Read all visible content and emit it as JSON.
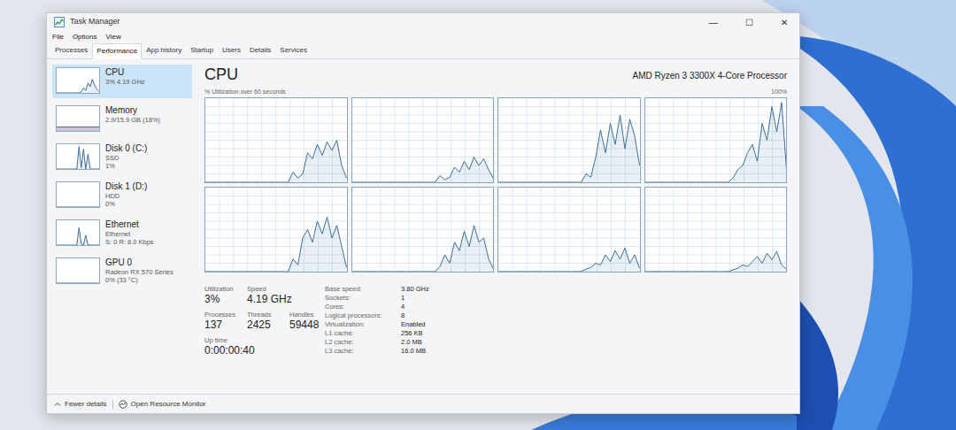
{
  "window": {
    "title": "Task Manager",
    "controls": [
      "—",
      "☐",
      "✕"
    ]
  },
  "menu": [
    "File",
    "Options",
    "View"
  ],
  "tabs": [
    {
      "label": "Processes",
      "selected": false
    },
    {
      "label": "Performance",
      "selected": true
    },
    {
      "label": "App history",
      "selected": false
    },
    {
      "label": "Startup",
      "selected": false
    },
    {
      "label": "Users",
      "selected": false
    },
    {
      "label": "Details",
      "selected": false
    },
    {
      "label": "Services",
      "selected": false
    }
  ],
  "sidebar": {
    "items": [
      {
        "title": "CPU",
        "lines": [
          "3% 4.19 GHz"
        ],
        "selected": true,
        "kind": "line",
        "values": [
          0,
          0,
          0,
          0,
          0,
          0,
          0,
          0,
          0,
          0,
          0,
          5,
          20,
          10,
          40,
          25,
          55,
          30,
          15,
          5
        ]
      },
      {
        "title": "Memory",
        "lines": [
          "2.9/15.9 GB (18%)"
        ],
        "selected": false,
        "kind": "fill",
        "level": 0.18
      },
      {
        "title": "Disk 0 (C:)",
        "lines": [
          "SSD",
          "1%"
        ],
        "selected": false,
        "kind": "line",
        "values": [
          0,
          0,
          0,
          0,
          0,
          0,
          0,
          0,
          0,
          0,
          90,
          5,
          80,
          0,
          60,
          0,
          0,
          0,
          0,
          0
        ]
      },
      {
        "title": "Disk 1 (D:)",
        "lines": [
          "HDD",
          "0%"
        ],
        "selected": false,
        "kind": "line",
        "values": [
          0,
          0,
          0,
          0,
          0,
          0,
          0,
          0,
          0,
          0,
          0,
          0,
          0,
          0,
          0,
          0,
          0,
          0,
          0,
          0
        ]
      },
      {
        "title": "Ethernet",
        "lines": [
          "Ethernet",
          "S: 0 R: 8.0 Kbps"
        ],
        "selected": false,
        "kind": "line",
        "values": [
          0,
          0,
          0,
          0,
          0,
          0,
          0,
          0,
          0,
          0,
          70,
          5,
          0,
          40,
          0,
          0,
          0,
          0,
          0,
          0
        ]
      },
      {
        "title": "GPU 0",
        "lines": [
          "Radeon RX 570 Series",
          "0% (33 °C)"
        ],
        "selected": false,
        "kind": "line",
        "values": [
          0,
          0,
          0,
          0,
          0,
          0,
          0,
          0,
          0,
          0,
          0,
          0,
          0,
          0,
          0,
          0,
          0,
          0,
          0,
          0
        ]
      }
    ]
  },
  "panel": {
    "title": "CPU",
    "device": "AMD Ryzen 3 3300X 4-Core Processor",
    "axis_label": "% Utilization over 60 seconds",
    "axis_max": "100%",
    "cores": [
      {
        "values": [
          0,
          0,
          0,
          0,
          0,
          0,
          0,
          0,
          0,
          0,
          0,
          0,
          0,
          0,
          0,
          0,
          0,
          0,
          12,
          5,
          10,
          35,
          28,
          45,
          32,
          48,
          38,
          50,
          20,
          5
        ]
      },
      {
        "values": [
          0,
          0,
          0,
          0,
          0,
          0,
          0,
          0,
          0,
          0,
          0,
          0,
          0,
          0,
          0,
          0,
          0,
          0,
          8,
          3,
          6,
          18,
          12,
          25,
          15,
          30,
          20,
          28,
          15,
          4
        ]
      },
      {
        "values": [
          0,
          0,
          0,
          0,
          0,
          0,
          0,
          0,
          0,
          0,
          0,
          0,
          0,
          0,
          0,
          0,
          0,
          0,
          10,
          6,
          30,
          62,
          35,
          70,
          45,
          80,
          40,
          75,
          55,
          20
        ]
      },
      {
        "values": [
          0,
          0,
          0,
          0,
          0,
          0,
          0,
          0,
          0,
          0,
          0,
          0,
          0,
          0,
          0,
          0,
          0,
          0,
          5,
          15,
          20,
          35,
          45,
          25,
          70,
          50,
          90,
          60,
          95,
          15
        ]
      },
      {
        "values": [
          0,
          0,
          0,
          0,
          0,
          0,
          0,
          0,
          0,
          0,
          0,
          0,
          0,
          0,
          0,
          0,
          0,
          0,
          15,
          8,
          40,
          50,
          35,
          60,
          45,
          65,
          40,
          55,
          30,
          5
        ]
      },
      {
        "values": [
          0,
          0,
          0,
          0,
          0,
          0,
          0,
          0,
          0,
          0,
          0,
          0,
          0,
          0,
          0,
          0,
          0,
          0,
          6,
          20,
          10,
          35,
          25,
          48,
          30,
          55,
          35,
          40,
          15,
          3
        ]
      },
      {
        "values": [
          0,
          0,
          0,
          0,
          0,
          0,
          0,
          0,
          0,
          0,
          0,
          0,
          0,
          0,
          0,
          0,
          0,
          0,
          3,
          5,
          10,
          8,
          20,
          12,
          25,
          15,
          28,
          10,
          20,
          4
        ]
      },
      {
        "values": [
          0,
          0,
          0,
          0,
          0,
          0,
          0,
          0,
          0,
          0,
          0,
          0,
          0,
          0,
          0,
          0,
          0,
          0,
          2,
          4,
          8,
          6,
          12,
          18,
          10,
          22,
          14,
          24,
          8,
          3
        ]
      }
    ],
    "stats": [
      [
        {
          "label": "Utilization",
          "value": "3%"
        },
        {
          "label": "Speed",
          "value": "4.19 GHz"
        }
      ],
      [
        {
          "label": "Processes",
          "value": "137"
        },
        {
          "label": "Threads",
          "value": "2425"
        },
        {
          "label": "Handles",
          "value": "59448"
        }
      ],
      [
        {
          "label": "Up time",
          "value": "0:00:00:40"
        }
      ]
    ],
    "details": [
      {
        "label": "Base speed:",
        "value": "3.80 GHz"
      },
      {
        "label": "Sockets:",
        "value": "1"
      },
      {
        "label": "Cores:",
        "value": "4"
      },
      {
        "label": "Logical processors:",
        "value": "8"
      },
      {
        "label": "Virtualization:",
        "value": "Enabled"
      },
      {
        "label": "L1 cache:",
        "value": "256 KB"
      },
      {
        "label": "L2 cache:",
        "value": "2.0 MB"
      },
      {
        "label": "L3 cache:",
        "value": "16.0 MB"
      }
    ]
  },
  "footer": {
    "fewer": "Fewer details",
    "monitor": "Open Resource Monitor"
  }
}
